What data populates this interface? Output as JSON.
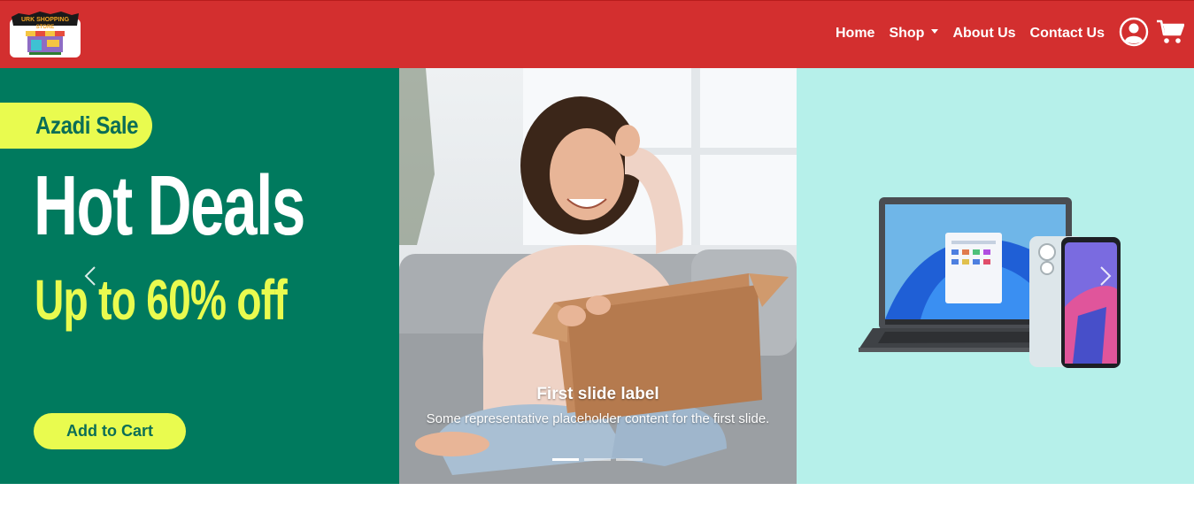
{
  "brand": {
    "logo_text_line1": "URK SHOPPING",
    "logo_text_line2": "STORE"
  },
  "nav": {
    "items": [
      {
        "label": "Home"
      },
      {
        "label": "Shop"
      },
      {
        "label": "About Us"
      },
      {
        "label": "Contact Us"
      }
    ],
    "icons": [
      "user-circle-icon",
      "shopping-cart-icon"
    ]
  },
  "carousel": {
    "slide1": {
      "badge": "Azadi Sale",
      "headline": "Hot Deals",
      "subheadline": "Up to 60% off",
      "cta": "Add to Cart"
    },
    "caption": {
      "title": "First slide label",
      "text": "Some representative placeholder content for the first slide."
    },
    "indicator_count": 3,
    "active_indicator": 0
  },
  "colors": {
    "navbar": "#d32f2f",
    "promo_green": "#007a5e",
    "promo_yellow": "#e9fb4f",
    "slide3_bg": "#b6f0ea"
  }
}
